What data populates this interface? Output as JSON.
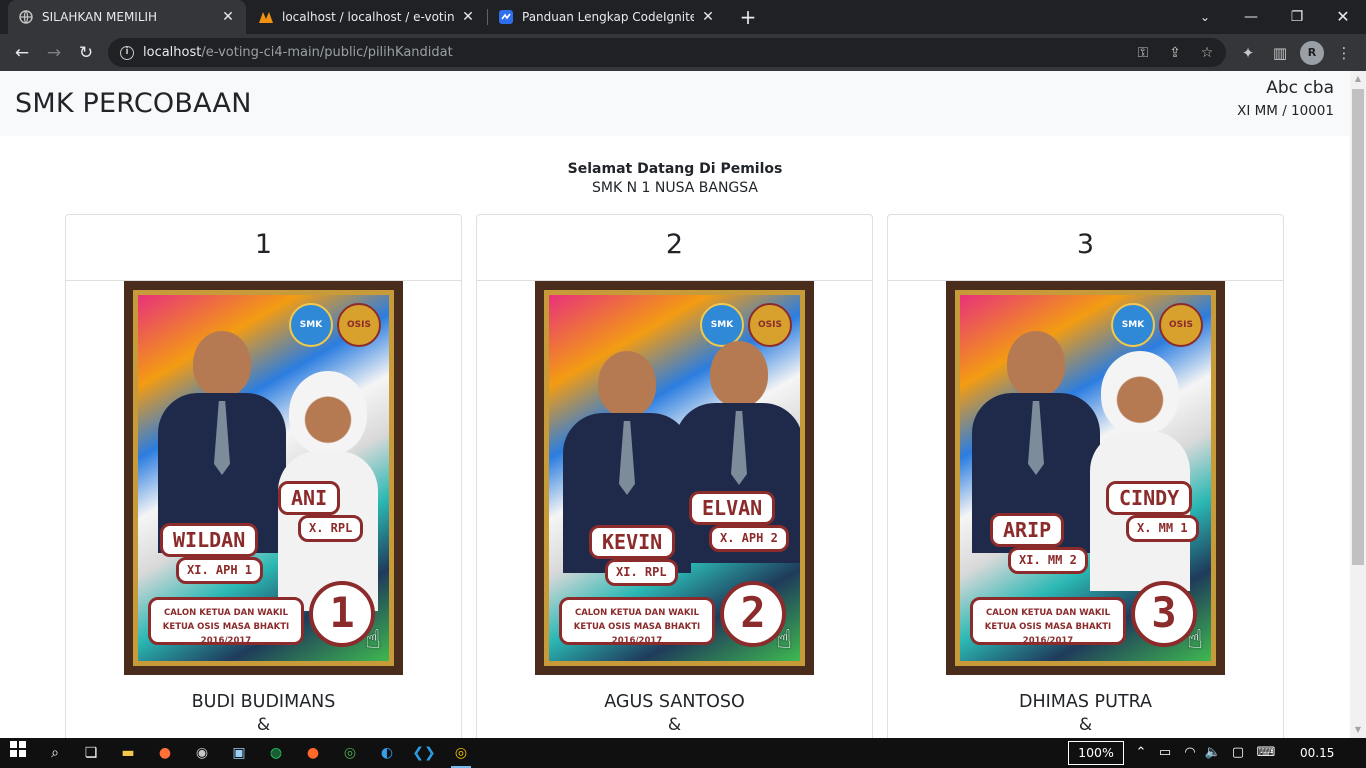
{
  "browser": {
    "tabs": [
      {
        "label": "SILAHKAN MEMILIH",
        "active": true
      },
      {
        "label": "localhost / localhost / e-voting-ci",
        "active": false
      },
      {
        "label": "Panduan Lengkap CodeIgniter 4",
        "active": false
      }
    ],
    "url_host": "localhost",
    "url_path": "/e-voting-ci4-main/public/pilihKandidat",
    "profile_initial": "R"
  },
  "header": {
    "brand": "SMK PERCOBAAN",
    "user_name": "Abc cba",
    "user_meta": "XI MM / 10001"
  },
  "welcome": {
    "title": "Selamat Datang Di Pemilos",
    "school": "SMK N 1 NUSA BANGSA"
  },
  "candidates": [
    {
      "number": "1",
      "name": "BUDI BUDIMANS",
      "separator": "&",
      "poster": {
        "ketua": "WILDAN",
        "ketua_class": "XI. APH 1",
        "wakil": "ANI",
        "wakil_class": "X. RPL",
        "caption": "CALON KETUA DAN WAKIL KETUA OSIS MASA BHAKTI 2016/2017",
        "badge": "1"
      }
    },
    {
      "number": "2",
      "name": "AGUS SANTOSO",
      "separator": "&",
      "poster": {
        "ketua": "KEVIN",
        "ketua_class": "XI. RPL",
        "wakil": "ELVAN",
        "wakil_class": "X. APH 2",
        "caption": "CALON KETUA DAN WAKIL KETUA OSIS MASA BHAKTI 2016/2017",
        "badge": "2"
      }
    },
    {
      "number": "3",
      "name": "DHIMAS PUTRA",
      "separator": "&",
      "poster": {
        "ketua": "ARIP",
        "ketua_class": "XI. MM 2",
        "wakil": "CINDY",
        "wakil_class": "X. MM 1",
        "caption": "CALON KETUA DAN WAKIL KETUA OSIS MASA BHAKTI 2016/2017",
        "badge": "3"
      }
    }
  ],
  "taskbar": {
    "zoom": "100%",
    "clock": "00.15"
  },
  "colors": {
    "chrome_dark": "#202124",
    "chrome_toolbar": "#35363a",
    "header_bg": "#f8f9fa",
    "poster_frame": "#4a2c1c",
    "poster_accent": "#8b2b2b"
  }
}
